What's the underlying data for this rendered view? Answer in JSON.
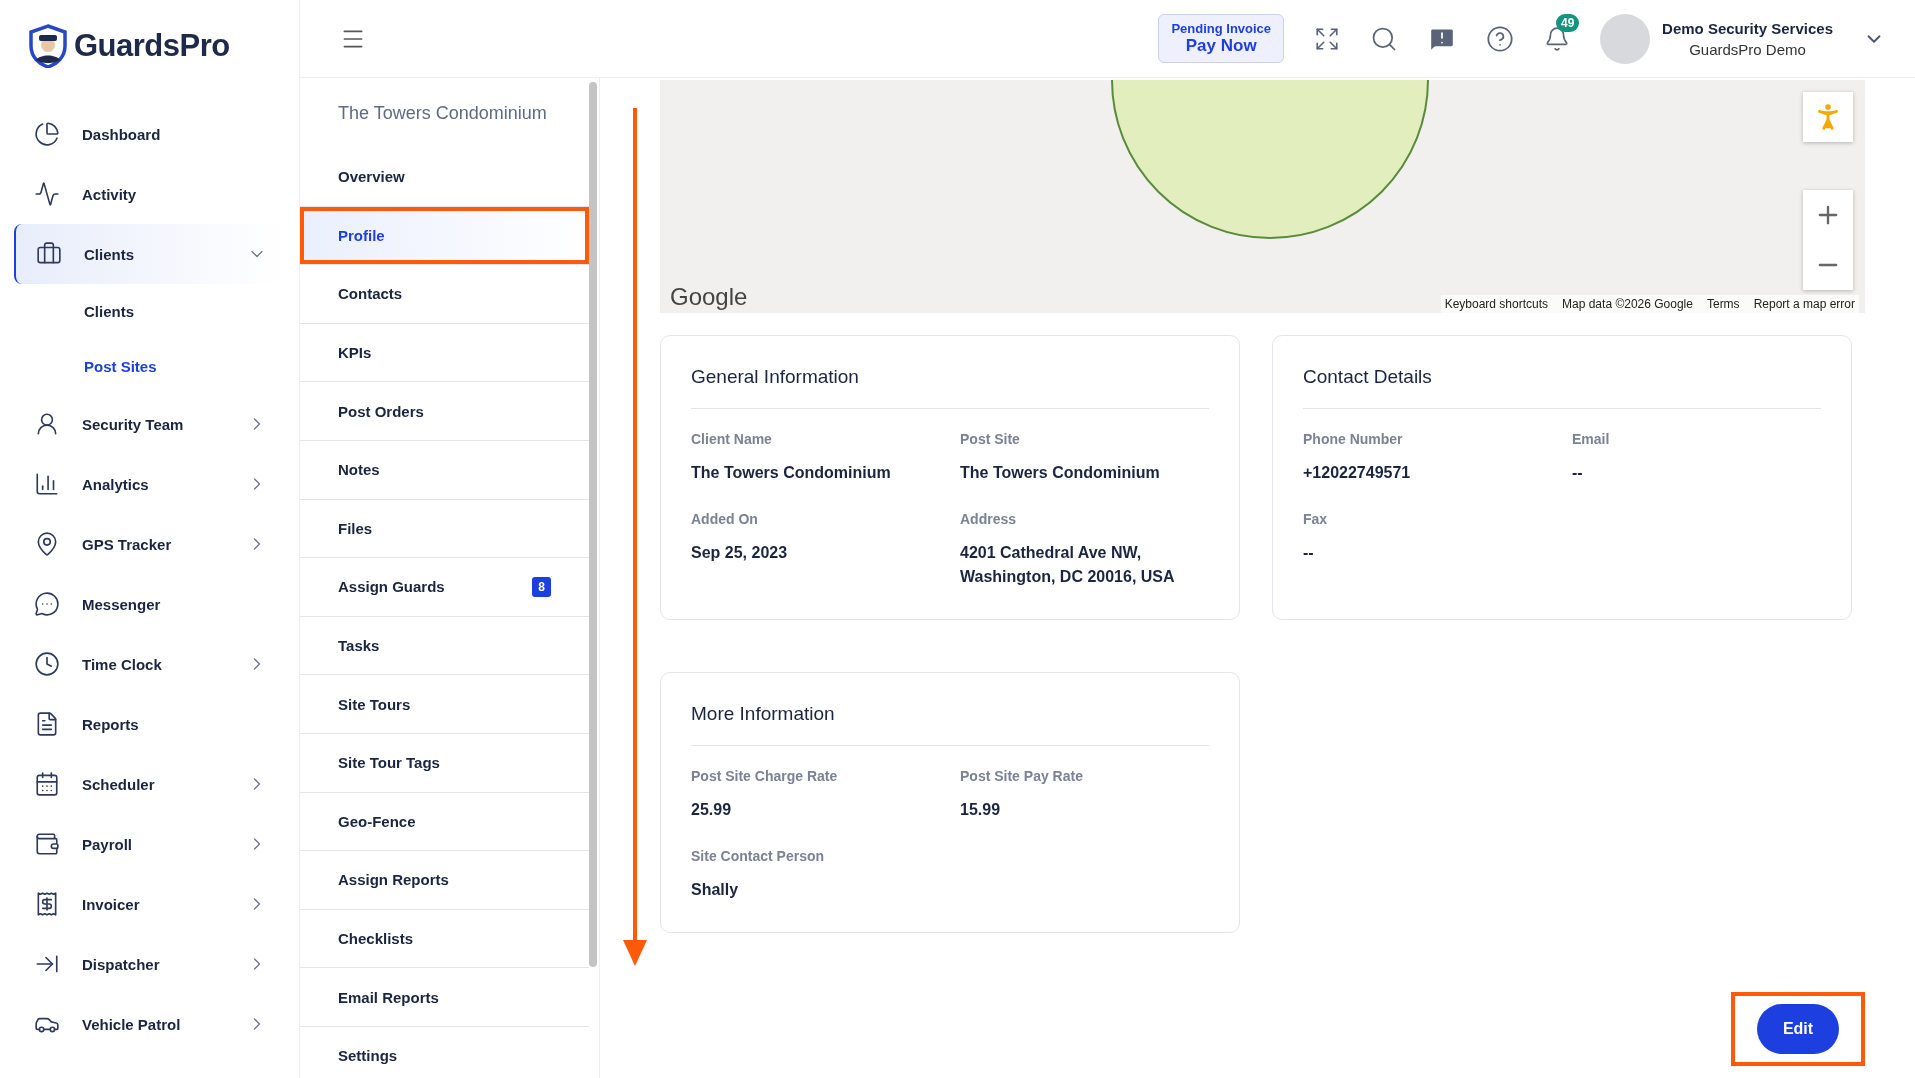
{
  "brand": {
    "name": "GuardsPro"
  },
  "sidebar": {
    "items": [
      {
        "label": "Dashboard",
        "selected": false
      },
      {
        "label": "Activity",
        "selected": false
      },
      {
        "label": "Clients",
        "selected": true,
        "expanded": true,
        "children": [
          {
            "label": "Clients",
            "selected": false
          },
          {
            "label": "Post Sites",
            "selected": true
          }
        ]
      },
      {
        "label": "Security Team",
        "selected": false,
        "expanded": false
      },
      {
        "label": "Analytics",
        "selected": false,
        "expanded": false
      },
      {
        "label": "GPS Tracker",
        "selected": false,
        "expanded": false
      },
      {
        "label": "Messenger",
        "selected": false
      },
      {
        "label": "Time Clock",
        "selected": false,
        "expanded": false
      },
      {
        "label": "Reports",
        "selected": false
      },
      {
        "label": "Scheduler",
        "selected": false,
        "expanded": false
      },
      {
        "label": "Payroll",
        "selected": false,
        "expanded": false
      },
      {
        "label": "Invoicer",
        "selected": false,
        "expanded": false
      },
      {
        "label": "Dispatcher",
        "selected": false,
        "expanded": false
      },
      {
        "label": "Vehicle Patrol",
        "selected": false,
        "expanded": false
      }
    ]
  },
  "header": {
    "invoice": {
      "label": "Pending Invoice",
      "action": "Pay Now"
    },
    "notifications": "49",
    "user": {
      "company": "Demo Security Services",
      "name": "GuardsPro Demo"
    }
  },
  "subnav": {
    "title": "The Towers Condominium",
    "items": [
      {
        "label": "Overview",
        "selected": false
      },
      {
        "label": "Profile",
        "selected": true
      },
      {
        "label": "Contacts",
        "selected": false
      },
      {
        "label": "KPIs",
        "selected": false
      },
      {
        "label": "Post Orders",
        "selected": false
      },
      {
        "label": "Notes",
        "selected": false
      },
      {
        "label": "Files",
        "selected": false
      },
      {
        "label": "Assign Guards",
        "selected": false,
        "badge": "8"
      },
      {
        "label": "Tasks",
        "selected": false
      },
      {
        "label": "Site Tours",
        "selected": false
      },
      {
        "label": "Site Tour Tags",
        "selected": false
      },
      {
        "label": "Geo-Fence",
        "selected": false
      },
      {
        "label": "Assign Reports",
        "selected": false
      },
      {
        "label": "Checklists",
        "selected": false
      },
      {
        "label": "Email Reports",
        "selected": false
      },
      {
        "label": "Settings",
        "selected": false
      }
    ]
  },
  "map": {
    "logo": "Google",
    "footer": [
      "Keyboard shortcuts",
      "Map data ©2026 Google",
      "Terms",
      "Report a map error"
    ]
  },
  "cards": [
    {
      "title": "General Information",
      "fields": [
        {
          "label": "Client Name",
          "value": "The Towers Condominium"
        },
        {
          "label": "Post Site",
          "value": "The Towers Condominium"
        },
        {
          "label": "Added On",
          "value": "Sep 25, 2023"
        },
        {
          "label": "Address",
          "value": "4201 Cathedral Ave NW, Washington, DC 20016, USA"
        }
      ]
    },
    {
      "title": "Contact Details",
      "fields": [
        {
          "label": "Phone Number",
          "value": "+12022749571"
        },
        {
          "label": "Email",
          "value": "--"
        },
        {
          "label": "Fax",
          "value": "--"
        }
      ]
    },
    {
      "title": "More Information",
      "fields": [
        {
          "label": "Post Site Charge Rate",
          "value": "25.99"
        },
        {
          "label": "Post Site Pay Rate",
          "value": "15.99"
        },
        {
          "label": "Site Contact Person",
          "value": "Shally"
        }
      ]
    }
  ],
  "edit_button": "Edit"
}
